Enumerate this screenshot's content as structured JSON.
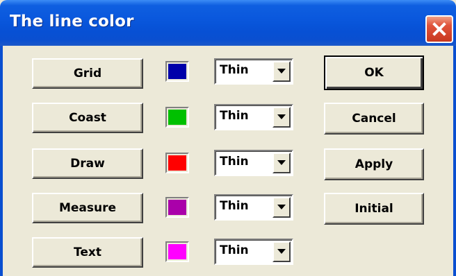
{
  "window": {
    "title": "The line color"
  },
  "line_items": [
    {
      "label": "Grid",
      "color": "#0000aa",
      "thickness": "Thin"
    },
    {
      "label": "Coast",
      "color": "#00c000",
      "thickness": "Thin"
    },
    {
      "label": "Draw",
      "color": "#ff0000",
      "thickness": "Thin"
    },
    {
      "label": "Measure",
      "color": "#aa00aa",
      "thickness": "Thin"
    },
    {
      "label": "Text",
      "color": "#ff00ff",
      "thickness": "Thin"
    }
  ],
  "actions": {
    "ok": "OK",
    "cancel": "Cancel",
    "apply": "Apply",
    "initial": "Initial"
  }
}
